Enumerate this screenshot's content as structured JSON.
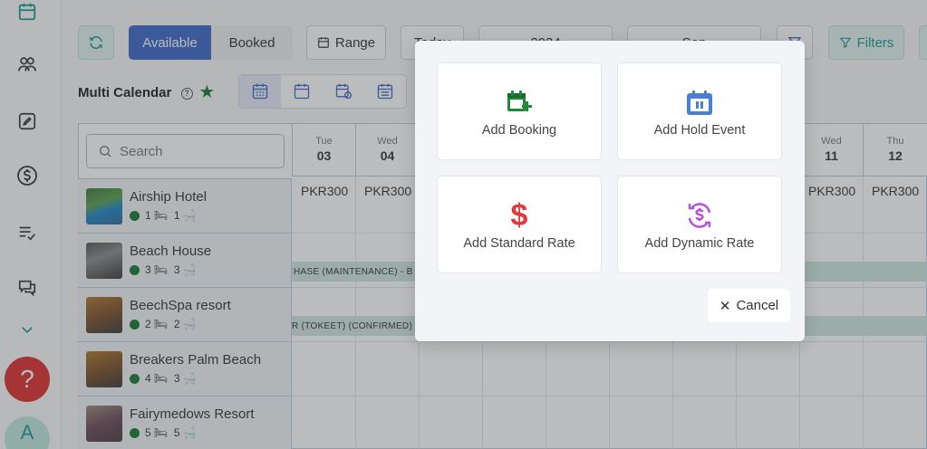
{
  "toolbar": {
    "available_label": "Available",
    "booked_label": "Booked",
    "range_label": "Range",
    "today_label": "Today",
    "year_value": "2024",
    "month_value": "Sep",
    "filters_label": "Filters"
  },
  "page": {
    "title": "Multi Calendar"
  },
  "search": {
    "placeholder": "Search"
  },
  "days": [
    {
      "name": "Tue",
      "date": "03"
    },
    {
      "name": "Wed",
      "date": "04"
    },
    {
      "name": "Wed",
      "date": "11"
    },
    {
      "name": "Thu",
      "date": "12"
    }
  ],
  "price_label": "PKR300",
  "properties": [
    {
      "name": "Airship Hotel",
      "beds": "1",
      "baths": "1"
    },
    {
      "name": "Beach House",
      "beds": "3",
      "baths": "3"
    },
    {
      "name": "BeechSpa resort",
      "beds": "2",
      "baths": "2"
    },
    {
      "name": "Breakers Palm Beach",
      "beds": "4",
      "baths": "3"
    },
    {
      "name": "Fairymedows Resort",
      "beds": "5",
      "baths": "5"
    }
  ],
  "bookings": [
    {
      "text": "HASE (MAINTENANCE) - B"
    },
    {
      "text": "R (TOKEET) (CONFIRMED) -"
    }
  ],
  "sidebar": {
    "help_label": "?",
    "avatar_initial": "A"
  },
  "modal": {
    "add_booking_label": "Add Booking",
    "add_hold_event_label": "Add Hold Event",
    "add_standard_rate_label": "Add Standard Rate",
    "add_dynamic_rate_label": "Add Dynamic Rate",
    "cancel_label": "Cancel"
  },
  "colors": {
    "primary_blue": "#3c67c8",
    "teal": "#1a9a93",
    "green_icon": "#1d8a3a",
    "blue_icon": "#4a7fd4",
    "red_icon": "#e03b3b",
    "purple_icon": "#b74fe0",
    "help_red": "#dc2f2f"
  }
}
